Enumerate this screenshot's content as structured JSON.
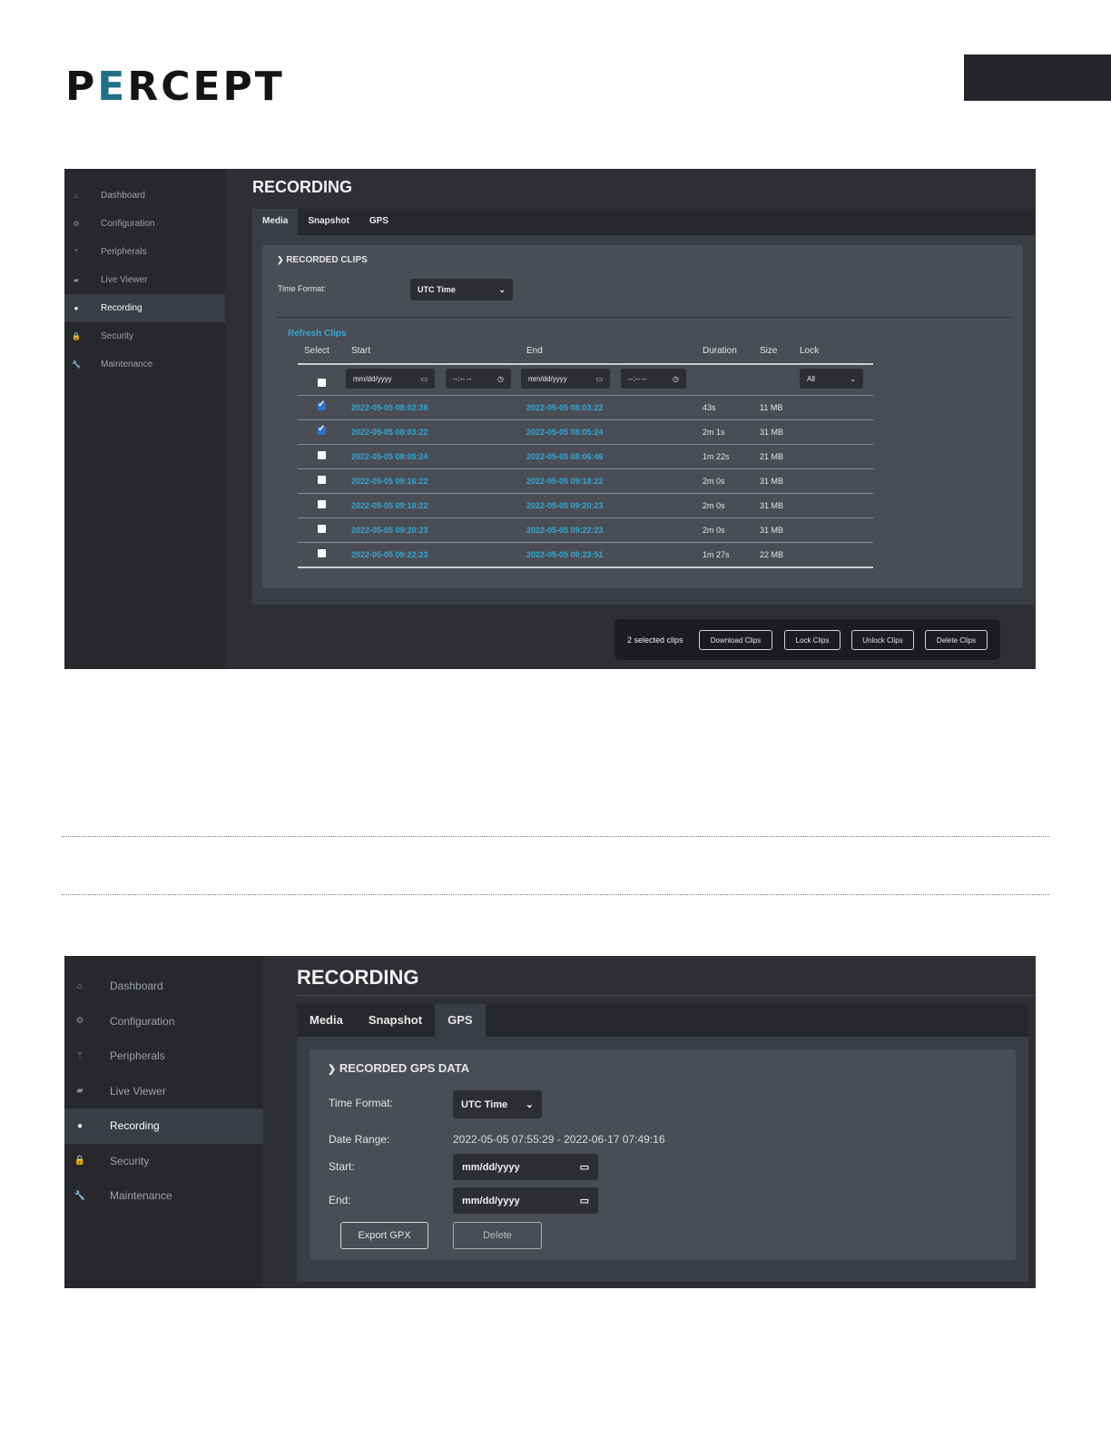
{
  "logo": {
    "text_a": "P",
    "text_e": "E",
    "text_rest": "RCEPT"
  },
  "nav": [
    {
      "label": "Dashboard",
      "icon": "home-icon",
      "glyph": "⌂"
    },
    {
      "label": "Configuration",
      "icon": "gear-icon",
      "glyph": "⚙"
    },
    {
      "label": "Peripherals",
      "icon": "usb-icon",
      "glyph": "ᛘ"
    },
    {
      "label": "Live Viewer",
      "icon": "camera-icon",
      "glyph": "▰"
    },
    {
      "label": "Recording",
      "icon": "record-dot-icon",
      "glyph": "●"
    },
    {
      "label": "Security",
      "icon": "lock-icon",
      "glyph": "🔒"
    },
    {
      "label": "Maintenance",
      "icon": "wrench-icon",
      "glyph": "🔧"
    }
  ],
  "active_nav": "Recording",
  "media_view": {
    "title": "RECORDING",
    "tabs": [
      "Media",
      "Snapshot",
      "GPS"
    ],
    "active_tab": "Media",
    "section_title": "RECORDED CLIPS",
    "time_format_label": "Time Format:",
    "time_format_value": "UTC Time",
    "refresh_label": "Refresh Clips",
    "columns": [
      "Select",
      "Start",
      "End",
      "Duration",
      "Size",
      "Lock"
    ],
    "filter": {
      "start_date_placeholder": "mm/dd/yyyy",
      "start_time_placeholder": "--:-- --",
      "end_date_placeholder": "mm/dd/yyyy",
      "end_time_placeholder": "--:-- --",
      "lock_value": "All"
    },
    "clips": [
      {
        "checked": true,
        "start": "2022-05-05 08:02:38",
        "end": "2022-05-05 08:03:22",
        "duration": "43s",
        "size": "11 MB"
      },
      {
        "checked": true,
        "start": "2022-05-05 08:03:22",
        "end": "2022-05-05 08:05:24",
        "duration": "2m 1s",
        "size": "31 MB"
      },
      {
        "checked": false,
        "start": "2022-05-05 08:05:24",
        "end": "2022-05-05 08:06:46",
        "duration": "1m 22s",
        "size": "21 MB"
      },
      {
        "checked": false,
        "start": "2022-05-05 09:16:22",
        "end": "2022-05-05 09:18:22",
        "duration": "2m 0s",
        "size": "31 MB"
      },
      {
        "checked": false,
        "start": "2022-05-05 09:18:22",
        "end": "2022-05-05 09:20:23",
        "duration": "2m 0s",
        "size": "31 MB"
      },
      {
        "checked": false,
        "start": "2022-05-05 09:20:23",
        "end": "2022-05-05 09:22:23",
        "duration": "2m 0s",
        "size": "31 MB"
      },
      {
        "checked": false,
        "start": "2022-05-05 09:22:23",
        "end": "2022-05-05 09:23:51",
        "duration": "1m 27s",
        "size": "22 MB"
      }
    ],
    "selection_text": "2 selected clips",
    "actions": [
      "Download Clips",
      "Lock Clips",
      "Unlock Clips",
      "Delete Clips"
    ]
  },
  "gps_view": {
    "title": "RECORDING",
    "tabs": [
      "Media",
      "Snapshot",
      "GPS"
    ],
    "active_tab": "GPS",
    "section_title": "RECORDED GPS DATA",
    "time_format_label": "Time Format:",
    "time_format_value": "UTC Time",
    "date_range_label": "Date Range:",
    "date_range_value": "2022-05-05 07:55:29 - 2022-06-17 07:49:16",
    "start_label": "Start:",
    "start_placeholder": "mm/dd/yyyy",
    "end_label": "End:",
    "end_placeholder": "mm/dd/yyyy",
    "export_label": "Export GPX",
    "delete_label": "Delete"
  },
  "colors": {
    "accent_link": "#32a8d6",
    "logo_accent": "#1f6f86",
    "checkbox_checked": "#2f6fd6"
  }
}
